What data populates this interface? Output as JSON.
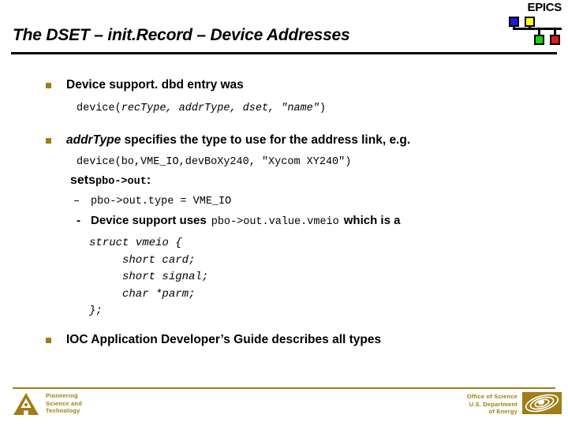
{
  "logo": {
    "wordmark": "EPICS",
    "squares": [
      {
        "name": "blue",
        "color": "#1a1ae0"
      },
      {
        "name": "yellow",
        "color": "#ffff2a"
      },
      {
        "name": "green",
        "color": "#18d018"
      },
      {
        "name": "red",
        "color": "#e01a1a"
      }
    ]
  },
  "slide": {
    "title": "The DSET – init.Record – Device Addresses",
    "bullet_color": "#a07d16"
  },
  "body": {
    "bullet1": {
      "text": "Device support. dbd entry was",
      "code_prefix": "device(",
      "code_params": "recType, addrType, dset, \"name\"",
      "code_suffix": ")"
    },
    "bullet2": {
      "emph": "addrType",
      "text": " specifies the type to use for the address link, e.g.",
      "code": "device(bo,VME_IO,devBoXy240, \"Xycom XY240\")",
      "sets_word": "sets",
      "sets_code": "pbo->out",
      "sets_colon": ":"
    },
    "sub1": {
      "dash": "–",
      "code": "pbo->out.type = VME_IO"
    },
    "sub2": {
      "dash": "-",
      "text_before": "Device support uses",
      "code": "pbo->out.value.vmeio",
      "text_after": "which is a"
    },
    "struct": "struct vmeio {\n     short card;\n     short signal;\n     char *parm;\n};",
    "bullet3": {
      "text": "IOC Application Developer’s Guide describes all types"
    }
  },
  "footer": {
    "rule_color": "#a07d16",
    "left_text": "Pioneering\nScience and\nTechnology",
    "right_text": "Office of Science\nU.S. Department\nof Energy"
  }
}
